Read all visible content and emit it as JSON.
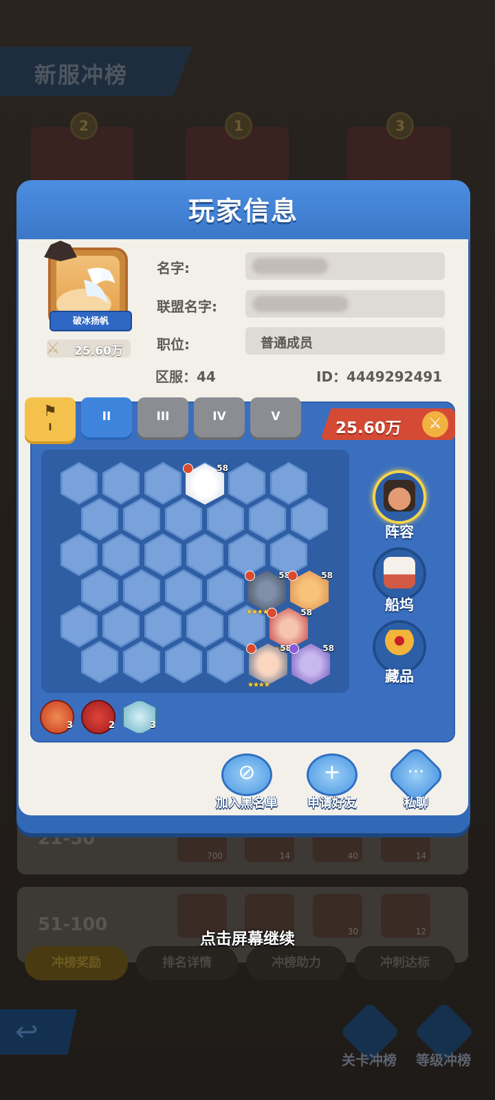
{
  "background": {
    "banner_title": "新服冲榜",
    "podium_ranks": [
      "2",
      "1",
      "3"
    ],
    "rows": [
      {
        "range": "21-50",
        "item_counts": [
          "700",
          "14",
          "40",
          "14"
        ]
      },
      {
        "range": "51-100",
        "item_counts": [
          "",
          "",
          "30",
          "12"
        ]
      }
    ],
    "tabs": [
      "冲榜奖励",
      "排名详情",
      "冲榜助力",
      "冲刺达标"
    ],
    "continue_hint": "点击屏幕继续",
    "bottom_buttons": [
      "关卡冲榜",
      "等级冲榜"
    ]
  },
  "panel": {
    "title": "玩家信息",
    "avatar_ribbon": "破冰扬帆",
    "avatar_power": "25.60万",
    "labels": {
      "name": "名字:",
      "alliance": "联盟名字:",
      "position": "职位:"
    },
    "position_value": "普通成员",
    "server": "区服：44",
    "player_id": "ID：4449292491",
    "formation_tabs": [
      "I",
      "II",
      "III",
      "IV",
      "V"
    ],
    "lineup_power": "25.60万",
    "heroes": [
      {
        "level": "58",
        "stars": ""
      },
      {
        "level": "58",
        "stars": "★★★★★"
      },
      {
        "level": "58",
        "stars": "★"
      },
      {
        "level": "58",
        "stars": "★★★★★"
      },
      {
        "level": "58",
        "stars": "★★★★"
      },
      {
        "level": "58",
        "stars": ""
      }
    ],
    "side_buttons": [
      "阵容",
      "船坞",
      "藏品"
    ],
    "synergies": [
      {
        "icon": "human-synergy-icon",
        "count": "3",
        "color": "#d94a2f"
      },
      {
        "icon": "beast-synergy-icon",
        "count": "2",
        "color": "#c42c28"
      },
      {
        "icon": "pirate-synergy-icon",
        "count": "3",
        "color": "#7ec3d4"
      }
    ],
    "actions": [
      "加入黑名单",
      "申请好友",
      "私聊"
    ]
  }
}
